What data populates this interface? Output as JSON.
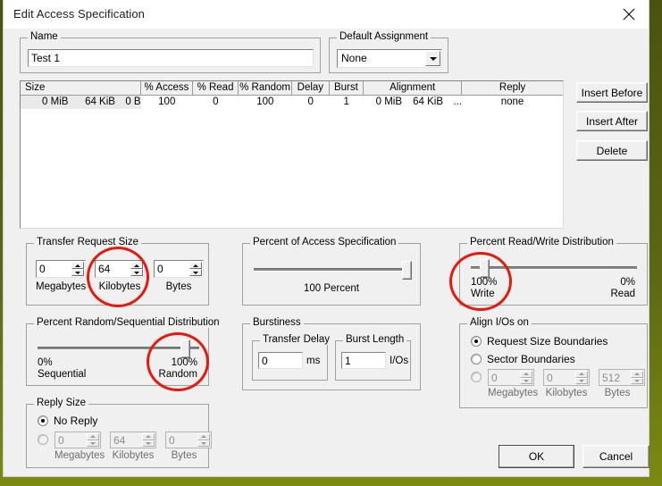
{
  "window": {
    "title": "Edit Access Specification",
    "close_icon": "close-icon"
  },
  "name_group": {
    "legend": "Name",
    "value": "Test 1"
  },
  "default_assignment": {
    "legend": "Default Assignment",
    "value": "None",
    "arrow_icon": "chevron-down-icon"
  },
  "spec_list": {
    "columns": [
      "Size",
      "% Access",
      "% Read",
      "% Random",
      "Delay",
      "Burst",
      "Alignment",
      "Reply"
    ],
    "rows": [
      {
        "size": [
          "0 MiB",
          "64 KiB",
          "0 B"
        ],
        "access": "100",
        "read": "0",
        "random": "100",
        "delay": "0",
        "burst": "1",
        "alignment": [
          "0 MiB",
          "64 KiB",
          "..."
        ],
        "reply": "none"
      }
    ]
  },
  "side_buttons": {
    "insert_before": "Insert Before",
    "insert_after": "Insert After",
    "delete": "Delete"
  },
  "transfer_request_size": {
    "legend": "Transfer Request Size",
    "megabytes": {
      "label": "Megabytes",
      "value": "0"
    },
    "kilobytes": {
      "label": "Kilobytes",
      "value": "64"
    },
    "bytes": {
      "label": "Bytes",
      "value": "0"
    }
  },
  "percent_of_access": {
    "legend": "Percent of Access Specification",
    "caption": "100 Percent",
    "slider_percent": 100
  },
  "percent_read_write": {
    "legend": "Percent Read/Write Distribution",
    "left_top": "100%",
    "left_bottom": "Write",
    "right_top": "0%",
    "right_bottom": "Read",
    "slider_percent": 0
  },
  "percent_random_sequential": {
    "legend": "Percent Random/Sequential Distribution",
    "left_top": "0%",
    "left_bottom": "Sequential",
    "right_top": "100%",
    "right_bottom": "Random",
    "slider_percent": 100
  },
  "burstiness": {
    "legend": "Burstiness",
    "transfer_delay": {
      "legend": "Transfer Delay",
      "value": "0",
      "unit": "ms"
    },
    "burst_length": {
      "legend": "Burst Length",
      "value": "1",
      "unit": "I/Os"
    }
  },
  "align_ios": {
    "legend": "Align I/Os on",
    "option_request_size": "Request Size Boundaries",
    "option_sector": "Sector Boundaries",
    "option_custom": "",
    "selected": "request_size",
    "megabytes": {
      "label": "Megabytes",
      "value": "0"
    },
    "kilobytes": {
      "label": "Kilobytes",
      "value": "0"
    },
    "bytes": {
      "label": "Bytes",
      "value": "512"
    }
  },
  "reply_size": {
    "legend": "Reply Size",
    "option_no_reply": "No Reply",
    "selected": "no_reply",
    "megabytes": {
      "label": "Megabytes",
      "value": "0"
    },
    "kilobytes": {
      "label": "Kilobytes",
      "value": "64"
    },
    "bytes": {
      "label": "Bytes",
      "value": "0"
    }
  },
  "footer": {
    "ok": "OK",
    "cancel": "Cancel"
  },
  "annotations": {
    "color": "#e8190c",
    "circles": [
      "kilobytes-transfer-size",
      "write-percent-slider",
      "random-percent-slider"
    ]
  }
}
